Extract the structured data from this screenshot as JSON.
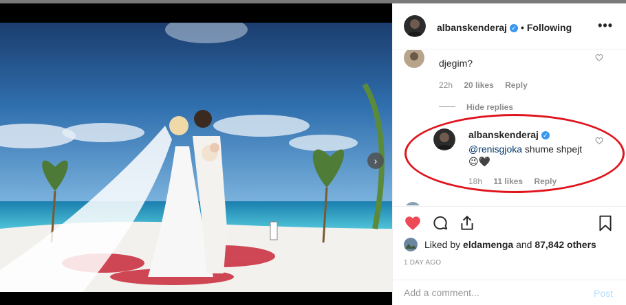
{
  "header": {
    "username": "albanskenderaj",
    "separator": "•",
    "follow_state": "Following",
    "more_label": "•••"
  },
  "comments": {
    "first": {
      "text": "djegim?",
      "time": "22h",
      "likes": "20 likes",
      "reply": "Reply"
    },
    "hide_replies": "Hide replies",
    "reply_comment": {
      "username": "albanskenderaj",
      "mention": "@renisgjoka",
      "text": " shume shpejt",
      "emoji": "😉🖤",
      "time": "18h",
      "likes": "11 likes",
      "reply": "Reply"
    }
  },
  "likes": {
    "prefix": "Liked by ",
    "liker": "eldamenga",
    "middle": " and ",
    "count": "87,842 others"
  },
  "time_ago": "1 DAY AGO",
  "add_comment": {
    "placeholder": "Add a comment...",
    "post_label": "Post"
  },
  "colors": {
    "heart": "#ed4956",
    "verified": "#3897f0",
    "annotation_ellipse": "#e0141d",
    "post_disabled": "#b2dffc"
  },
  "icons": [
    "verified-badge-icon",
    "more-options-icon",
    "heart-icon",
    "comment-icon",
    "share-icon",
    "bookmark-icon",
    "next-arrow-icon"
  ]
}
